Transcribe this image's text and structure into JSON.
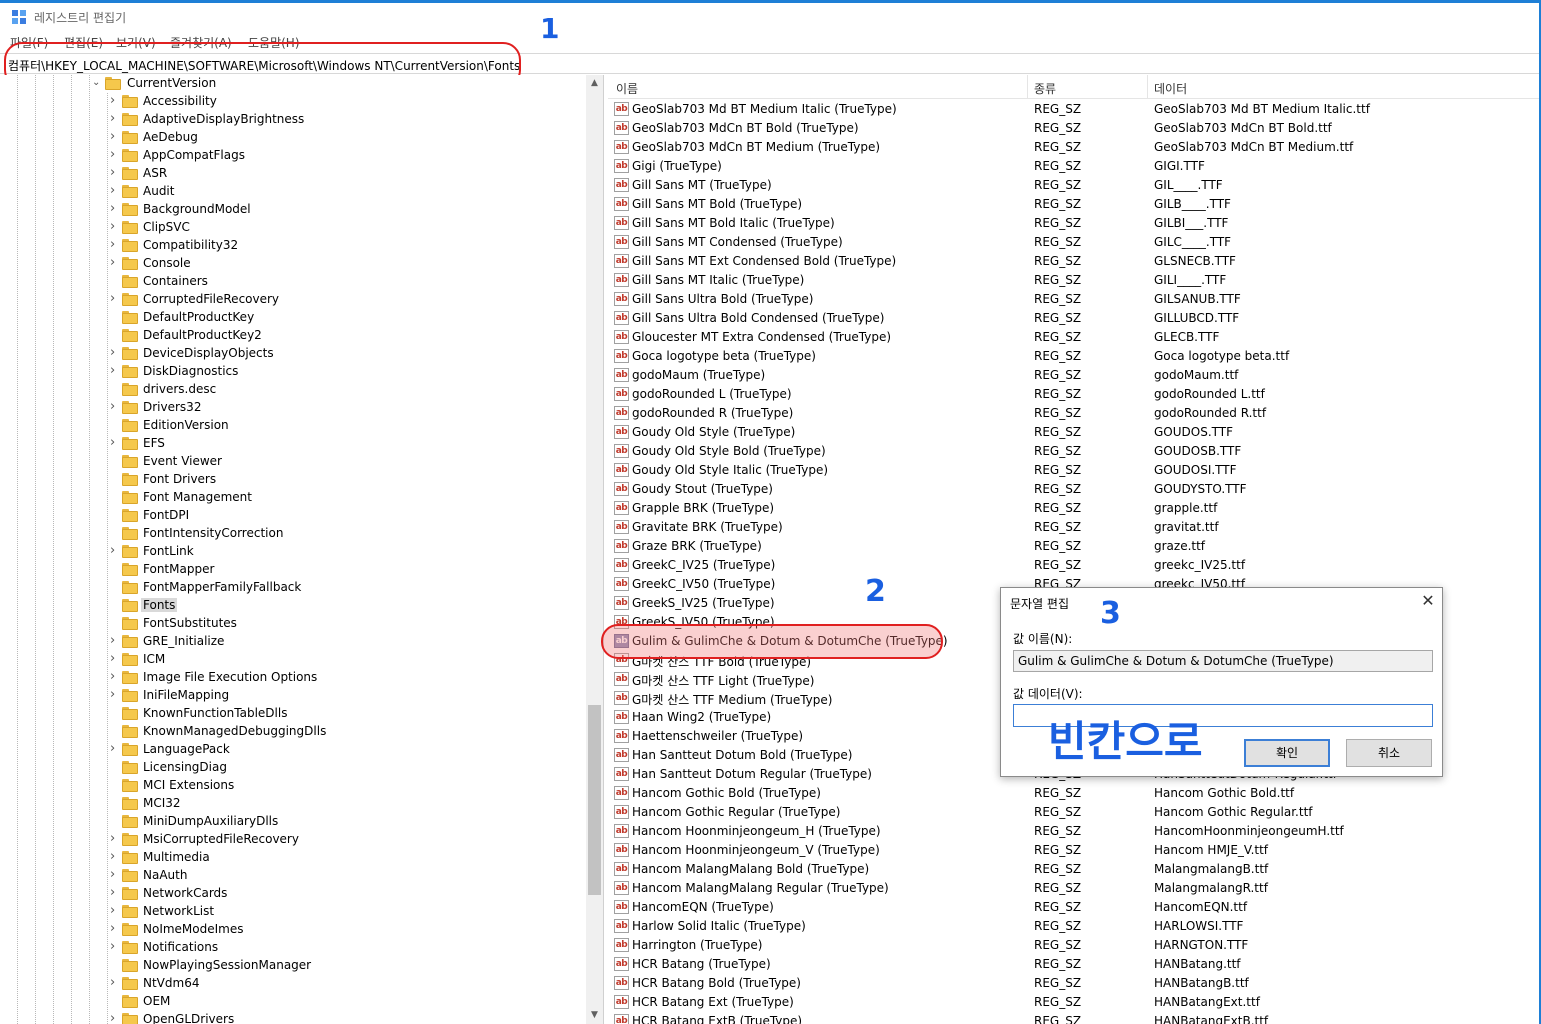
{
  "window": {
    "title": "레지스트리 편집기",
    "accent_color": "#1e7fd6"
  },
  "menu": [
    "파일(F)",
    "편집(E)",
    "보기(V)",
    "즐겨찾기(A)",
    "도움말(H)"
  ],
  "address": "컴퓨터\\HKEY_LOCAL_MACHINE\\SOFTWARE\\Microsoft\\Windows NT\\CurrentVersion\\Fonts",
  "tree": {
    "parent": "CurrentVersion",
    "items": [
      {
        "label": "Accessibility",
        "expandable": true
      },
      {
        "label": "AdaptiveDisplayBrightness",
        "expandable": true
      },
      {
        "label": "AeDebug",
        "expandable": true
      },
      {
        "label": "AppCompatFlags",
        "expandable": true
      },
      {
        "label": "ASR",
        "expandable": true
      },
      {
        "label": "Audit",
        "expandable": true
      },
      {
        "label": "BackgroundModel",
        "expandable": true
      },
      {
        "label": "ClipSVC",
        "expandable": true
      },
      {
        "label": "Compatibility32",
        "expandable": true
      },
      {
        "label": "Console",
        "expandable": true
      },
      {
        "label": "Containers",
        "expandable": false
      },
      {
        "label": "CorruptedFileRecovery",
        "expandable": true
      },
      {
        "label": "DefaultProductKey",
        "expandable": false
      },
      {
        "label": "DefaultProductKey2",
        "expandable": false
      },
      {
        "label": "DeviceDisplayObjects",
        "expandable": true
      },
      {
        "label": "DiskDiagnostics",
        "expandable": true
      },
      {
        "label": "drivers.desc",
        "expandable": false
      },
      {
        "label": "Drivers32",
        "expandable": true
      },
      {
        "label": "EditionVersion",
        "expandable": false
      },
      {
        "label": "EFS",
        "expandable": true
      },
      {
        "label": "Event Viewer",
        "expandable": false
      },
      {
        "label": "Font Drivers",
        "expandable": false
      },
      {
        "label": "Font Management",
        "expandable": false
      },
      {
        "label": "FontDPI",
        "expandable": false
      },
      {
        "label": "FontIntensityCorrection",
        "expandable": false
      },
      {
        "label": "FontLink",
        "expandable": true
      },
      {
        "label": "FontMapper",
        "expandable": false
      },
      {
        "label": "FontMapperFamilyFallback",
        "expandable": false
      },
      {
        "label": "Fonts",
        "expandable": false,
        "selected": true
      },
      {
        "label": "FontSubstitutes",
        "expandable": false
      },
      {
        "label": "GRE_Initialize",
        "expandable": true
      },
      {
        "label": "ICM",
        "expandable": true
      },
      {
        "label": "Image File Execution Options",
        "expandable": true
      },
      {
        "label": "IniFileMapping",
        "expandable": true
      },
      {
        "label": "KnownFunctionTableDlls",
        "expandable": false
      },
      {
        "label": "KnownManagedDebuggingDlls",
        "expandable": false
      },
      {
        "label": "LanguagePack",
        "expandable": true
      },
      {
        "label": "LicensingDiag",
        "expandable": false
      },
      {
        "label": "MCI Extensions",
        "expandable": false
      },
      {
        "label": "MCI32",
        "expandable": false
      },
      {
        "label": "MiniDumpAuxiliaryDlls",
        "expandable": false
      },
      {
        "label": "MsiCorruptedFileRecovery",
        "expandable": true
      },
      {
        "label": "Multimedia",
        "expandable": true
      },
      {
        "label": "NaAuth",
        "expandable": true
      },
      {
        "label": "NetworkCards",
        "expandable": true
      },
      {
        "label": "NetworkList",
        "expandable": true
      },
      {
        "label": "NoImeModeImes",
        "expandable": true
      },
      {
        "label": "Notifications",
        "expandable": true
      },
      {
        "label": "NowPlayingSessionManager",
        "expandable": false
      },
      {
        "label": "NtVdm64",
        "expandable": true
      },
      {
        "label": "OEM",
        "expandable": false
      },
      {
        "label": "OpenGLDrivers",
        "expandable": true
      }
    ]
  },
  "list": {
    "columns": [
      "이름",
      "종류",
      "데이터"
    ],
    "rows": [
      [
        "GeoSlab703 Md BT Medium Italic (TrueType)",
        "REG_SZ",
        "GeoSlab703 Md BT Medium Italic.ttf"
      ],
      [
        "GeoSlab703 MdCn BT Bold (TrueType)",
        "REG_SZ",
        "GeoSlab703 MdCn BT Bold.ttf"
      ],
      [
        "GeoSlab703 MdCn BT Medium (TrueType)",
        "REG_SZ",
        "GeoSlab703 MdCn BT Medium.ttf"
      ],
      [
        "Gigi (TrueType)",
        "REG_SZ",
        "GIGI.TTF"
      ],
      [
        "Gill Sans MT (TrueType)",
        "REG_SZ",
        "GIL____.TTF"
      ],
      [
        "Gill Sans MT Bold (TrueType)",
        "REG_SZ",
        "GILB____.TTF"
      ],
      [
        "Gill Sans MT Bold Italic (TrueType)",
        "REG_SZ",
        "GILBI___.TTF"
      ],
      [
        "Gill Sans MT Condensed (TrueType)",
        "REG_SZ",
        "GILC____.TTF"
      ],
      [
        "Gill Sans MT Ext Condensed Bold (TrueType)",
        "REG_SZ",
        "GLSNECB.TTF"
      ],
      [
        "Gill Sans MT Italic (TrueType)",
        "REG_SZ",
        "GILI____.TTF"
      ],
      [
        "Gill Sans Ultra Bold (TrueType)",
        "REG_SZ",
        "GILSANUB.TTF"
      ],
      [
        "Gill Sans Ultra Bold Condensed (TrueType)",
        "REG_SZ",
        "GILLUBCD.TTF"
      ],
      [
        "Gloucester MT Extra Condensed (TrueType)",
        "REG_SZ",
        "GLECB.TTF"
      ],
      [
        "Goca logotype beta (TrueType)",
        "REG_SZ",
        "Goca logotype beta.ttf"
      ],
      [
        "godoMaum (TrueType)",
        "REG_SZ",
        "godoMaum.ttf"
      ],
      [
        "godoRounded L (TrueType)",
        "REG_SZ",
        "godoRounded L.ttf"
      ],
      [
        "godoRounded R (TrueType)",
        "REG_SZ",
        "godoRounded R.ttf"
      ],
      [
        "Goudy Old Style (TrueType)",
        "REG_SZ",
        "GOUDOS.TTF"
      ],
      [
        "Goudy Old Style Bold (TrueType)",
        "REG_SZ",
        "GOUDOSB.TTF"
      ],
      [
        "Goudy Old Style Italic (TrueType)",
        "REG_SZ",
        "GOUDOSI.TTF"
      ],
      [
        "Goudy Stout (TrueType)",
        "REG_SZ",
        "GOUDYSTO.TTF"
      ],
      [
        "Grapple BRK (TrueType)",
        "REG_SZ",
        "grapple.ttf"
      ],
      [
        "Gravitate BRK (TrueType)",
        "REG_SZ",
        "gravitat.ttf"
      ],
      [
        "Graze BRK (TrueType)",
        "REG_SZ",
        "graze.ttf"
      ],
      [
        "GreekC_IV25 (TrueType)",
        "REG_SZ",
        "greekc_IV25.ttf"
      ],
      [
        "GreekC_IV50 (TrueType)",
        "REG_SZ",
        "greekc_IV50.ttf"
      ],
      [
        "GreekS_IV25 (TrueType)",
        "",
        ""
      ],
      [
        "GreekS_IV50 (TrueType)",
        "",
        ""
      ],
      [
        "Gulim & GulimChe & Dotum & DotumChe (TrueType)",
        "",
        ""
      ],
      [
        "G마켓 산스 TTF Bold (TrueType)",
        "",
        ""
      ],
      [
        "G마켓 산스 TTF Light (TrueType)",
        "",
        ""
      ],
      [
        "G마켓 산스 TTF Medium (TrueType)",
        "",
        ""
      ],
      [
        "Haan Wing2 (TrueType)",
        "",
        ""
      ],
      [
        "Haettenschweiler (TrueType)",
        "",
        ""
      ],
      [
        "Han Santteut Dotum Bold (TrueType)",
        "",
        ""
      ],
      [
        "Han Santteut Dotum Regular (TrueType)",
        "REG_SZ",
        "HanSantteutDotum-Regular.ttf"
      ],
      [
        "Hancom Gothic Bold (TrueType)",
        "REG_SZ",
        "Hancom Gothic Bold.ttf"
      ],
      [
        "Hancom Gothic Regular (TrueType)",
        "REG_SZ",
        "Hancom Gothic Regular.ttf"
      ],
      [
        "Hancom Hoonminjeongeum_H (TrueType)",
        "REG_SZ",
        "HancomHoonminjeongeumH.ttf"
      ],
      [
        "Hancom Hoonminjeongeum_V (TrueType)",
        "REG_SZ",
        "Hancom HMJE_V.ttf"
      ],
      [
        "Hancom MalangMalang Bold (TrueType)",
        "REG_SZ",
        "MalangmalangB.ttf"
      ],
      [
        "Hancom MalangMalang Regular (TrueType)",
        "REG_SZ",
        "MalangmalangR.ttf"
      ],
      [
        "HancomEQN (TrueType)",
        "REG_SZ",
        "HancomEQN.ttf"
      ],
      [
        "Harlow Solid Italic (TrueType)",
        "REG_SZ",
        "HARLOWSI.TTF"
      ],
      [
        "Harrington (TrueType)",
        "REG_SZ",
        "HARNGTON.TTF"
      ],
      [
        "HCR Batang (TrueType)",
        "REG_SZ",
        "HANBatang.ttf"
      ],
      [
        "HCR Batang Bold (TrueType)",
        "REG_SZ",
        "HANBatangB.ttf"
      ],
      [
        "HCR Batang Ext (TrueType)",
        "REG_SZ",
        "HANBatangExt.ttf"
      ],
      [
        "HCR Batang ExtB (TrueType)",
        "REG_SZ",
        "HANBatangExtB.ttf"
      ]
    ],
    "selected_index": 28,
    "icon_label": "ab"
  },
  "dialog": {
    "title": "문자열 편집",
    "name_label": "값 이름(N):",
    "name_value": "Gulim & GulimChe & Dotum & DotumChe (TrueType)",
    "data_label": "값 데이터(V):",
    "data_value": "",
    "ok_label": "확인",
    "cancel_label": "취소",
    "close_glyph": "✕"
  },
  "annotations": {
    "step1": "1",
    "step2": "2",
    "step3": "3",
    "note": "빈칸으로",
    "number_color": "#1a5fe0",
    "ellipse_color": "#e02020"
  }
}
